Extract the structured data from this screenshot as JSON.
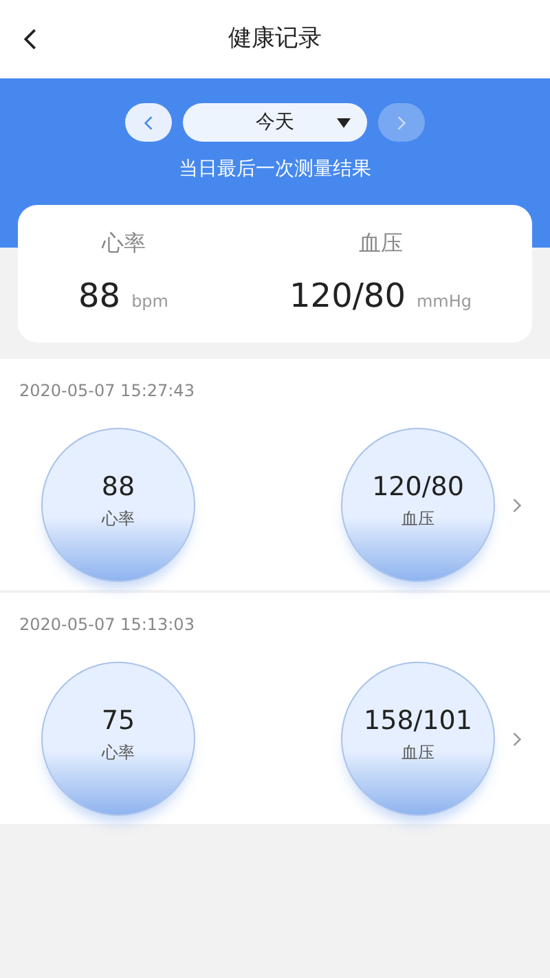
{
  "header": {
    "title": "健康记录"
  },
  "date_picker": {
    "value": "今天",
    "prev_disabled": false,
    "next_disabled": true
  },
  "summary": {
    "caption": "当日最后一次测量结果",
    "metrics": [
      {
        "label": "心率",
        "value": "88",
        "unit": "bpm"
      },
      {
        "label": "血压",
        "value": "120/80",
        "unit": "mmHg"
      }
    ]
  },
  "records": [
    {
      "time": "2020-05-07 15:27:43",
      "readings": [
        {
          "value": "88",
          "label": "心率"
        },
        {
          "value": "120/80",
          "label": "血压"
        }
      ]
    },
    {
      "time": "2020-05-07 15:13:03",
      "readings": [
        {
          "value": "75",
          "label": "心率"
        },
        {
          "value": "158/101",
          "label": "血压"
        }
      ]
    }
  ]
}
